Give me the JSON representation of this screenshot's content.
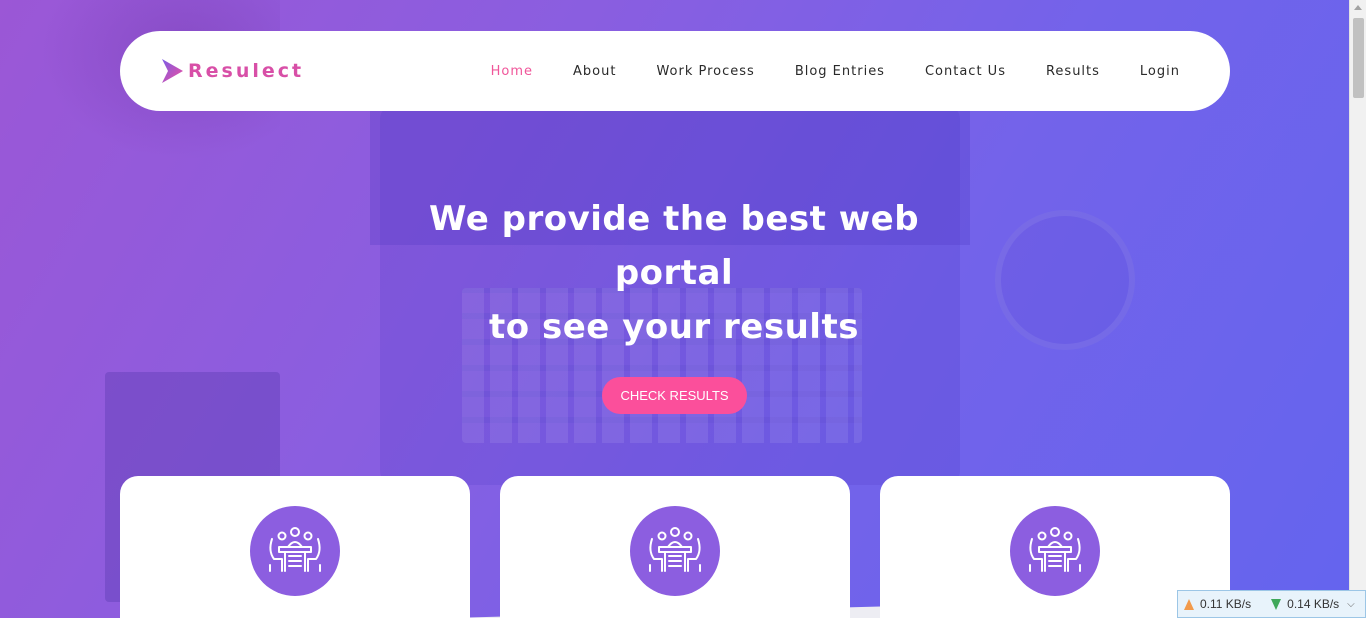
{
  "brand": {
    "name": "Resulect"
  },
  "nav": {
    "items": [
      {
        "label": "Home",
        "active": true
      },
      {
        "label": "About"
      },
      {
        "label": "Work Process"
      },
      {
        "label": "Blog Entries"
      },
      {
        "label": "Contact Us"
      },
      {
        "label": "Results"
      },
      {
        "label": "Login"
      }
    ]
  },
  "hero": {
    "line1_normal": "We provide the best ",
    "line1_bold": "web portal",
    "line2_normal": "to see your ",
    "line2_bold": "results",
    "cta_label": "CHECK RESULTS"
  },
  "cards": [
    {
      "icon": "meeting-icon"
    },
    {
      "icon": "meeting-icon"
    },
    {
      "icon": "meeting-icon"
    }
  ],
  "netspeed": {
    "upload": "0.11 KB/s",
    "download": "0.14 KB/s"
  },
  "colors": {
    "accent_pink": "#fb4f9b",
    "nav_active": "#f0569a",
    "icon_circle": "#8c5ee0",
    "gradient_start": "#9b57d6",
    "gradient_end": "#6464ee"
  }
}
